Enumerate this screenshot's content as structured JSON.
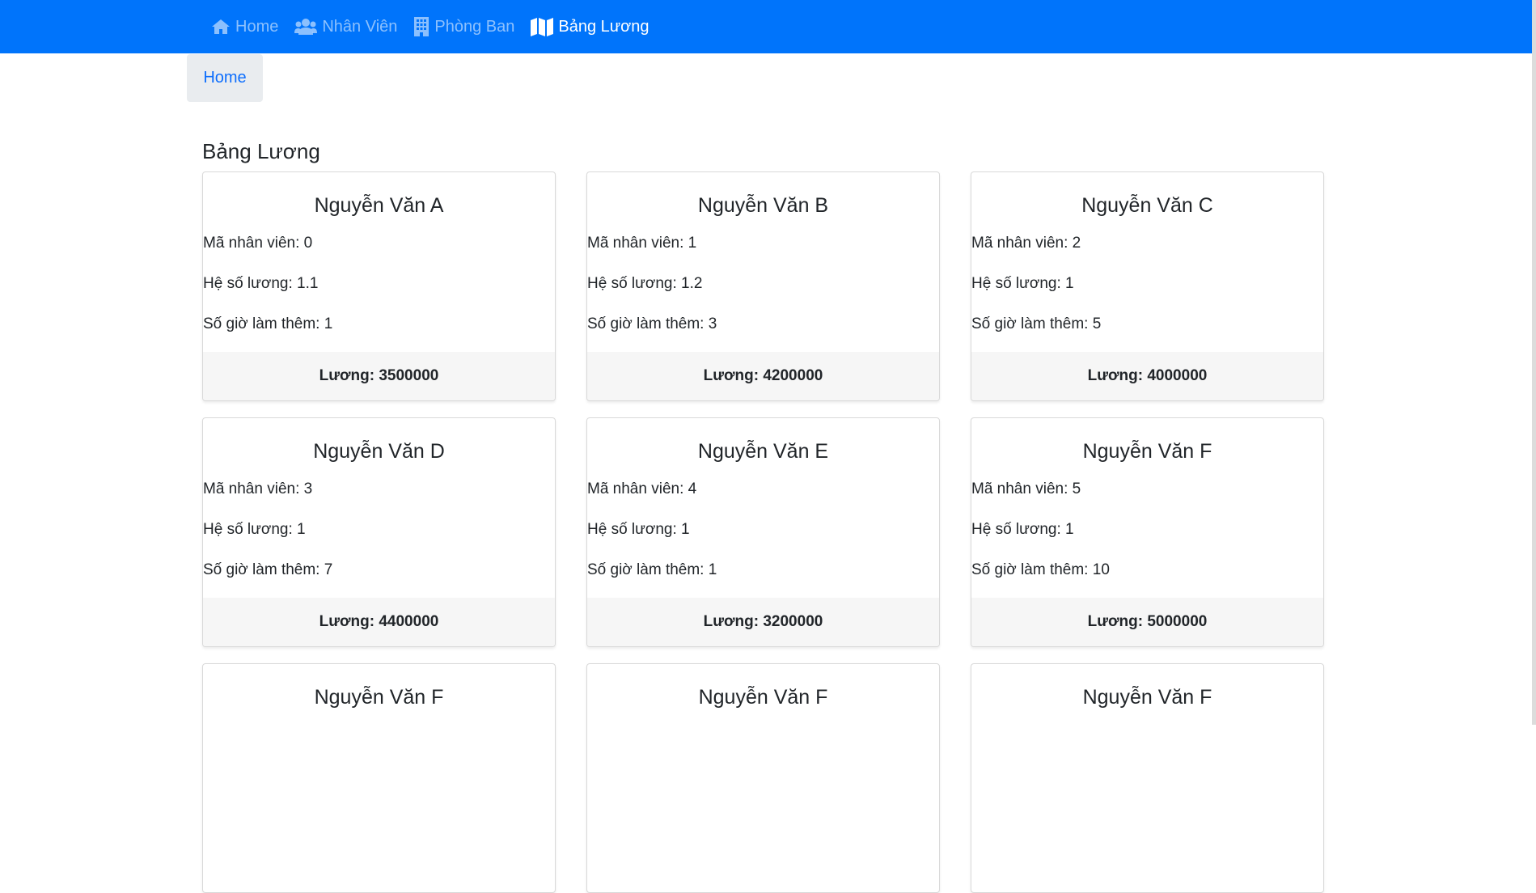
{
  "nav": {
    "items": [
      {
        "label": "Home",
        "icon": "home-icon"
      },
      {
        "label": "Nhân Viên",
        "icon": "users-icon"
      },
      {
        "label": "Phòng Ban",
        "icon": "building-icon"
      },
      {
        "label": "Bảng Lương",
        "icon": "map-icon"
      }
    ],
    "active_index": 3,
    "bg_color": "#0074fb"
  },
  "breadcrumb": {
    "label": "Home"
  },
  "page": {
    "title": "Bảng Lương"
  },
  "labels": {
    "id": "Mã nhân viên: ",
    "coef": "Hệ số lương: ",
    "overtime": "Số giờ làm thêm: ",
    "salary": "Lương: "
  },
  "employees": [
    {
      "name": "Nguyễn Văn A",
      "id": "0",
      "coef": "1.1",
      "overtime": "1",
      "salary": "3500000"
    },
    {
      "name": "Nguyễn Văn B",
      "id": "1",
      "coef": "1.2",
      "overtime": "3",
      "salary": "4200000"
    },
    {
      "name": "Nguyễn Văn C",
      "id": "2",
      "coef": "1",
      "overtime": "5",
      "salary": "4000000"
    },
    {
      "name": "Nguyễn Văn D",
      "id": "3",
      "coef": "1",
      "overtime": "7",
      "salary": "4400000"
    },
    {
      "name": "Nguyễn Văn E",
      "id": "4",
      "coef": "1",
      "overtime": "1",
      "salary": "3200000"
    },
    {
      "name": "Nguyễn Văn F",
      "id": "5",
      "coef": "1",
      "overtime": "10",
      "salary": "5000000"
    },
    {
      "name": "Nguyễn Văn F"
    },
    {
      "name": "Nguyễn Văn F"
    },
    {
      "name": "Nguyễn Văn F"
    }
  ]
}
